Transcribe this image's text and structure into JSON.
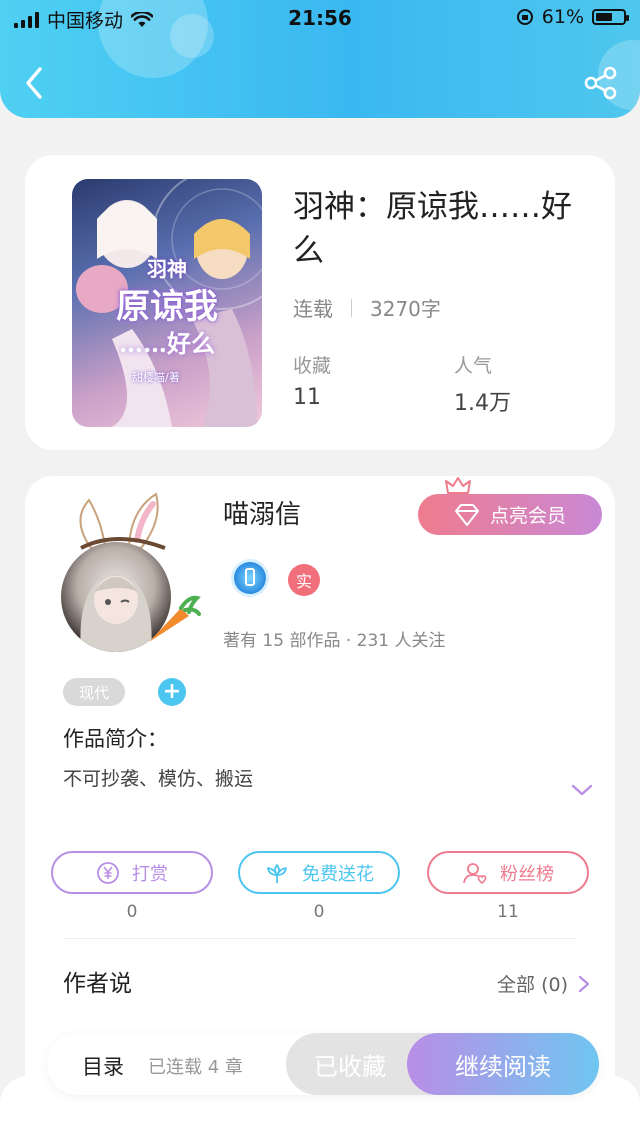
{
  "status_bar": {
    "carrier": "中国移动",
    "time": "21:56",
    "battery": "61%",
    "battery_level": 0.61
  },
  "header": {
    "back_icon": "chevron-left-icon",
    "share_icon": "share-icon"
  },
  "book": {
    "title": "羽神：原谅我……好么",
    "status": "连载",
    "word_count": "3270字",
    "favorites_label": "收藏",
    "favorites_value": "11",
    "popularity_label": "人气",
    "popularity_value": "1.4万",
    "cover": {
      "top": "羽神",
      "main": "原谅我",
      "sub": "……好么",
      "author": "甜樱喵/著"
    }
  },
  "author": {
    "name": "喵溺信",
    "vip_button": "点亮会员",
    "real_badge": "实",
    "works_info": "著有 15 部作品 · 231 人关注",
    "tag": "现代",
    "tag_add": "+",
    "intro_title": "作品简介：",
    "intro_text": "不可抄袭、模仿、搬运"
  },
  "actions": [
    {
      "label": "打赏",
      "count": "0",
      "icon": "yen-coin-icon",
      "color": "#b98ee6"
    },
    {
      "label": "免费送花",
      "count": "0",
      "icon": "flower-icon",
      "color": "#4cc6ef"
    },
    {
      "label": "粉丝榜",
      "count": "11",
      "icon": "fan-user-icon",
      "color": "#ef7b8e"
    }
  ],
  "author_says": {
    "title": "作者说",
    "all_link": "全部 (0)"
  },
  "bottom_bar": {
    "toc": "目录",
    "toc_sub": "已连载 4 章",
    "collected": "已收藏",
    "continue": "继续阅读"
  }
}
